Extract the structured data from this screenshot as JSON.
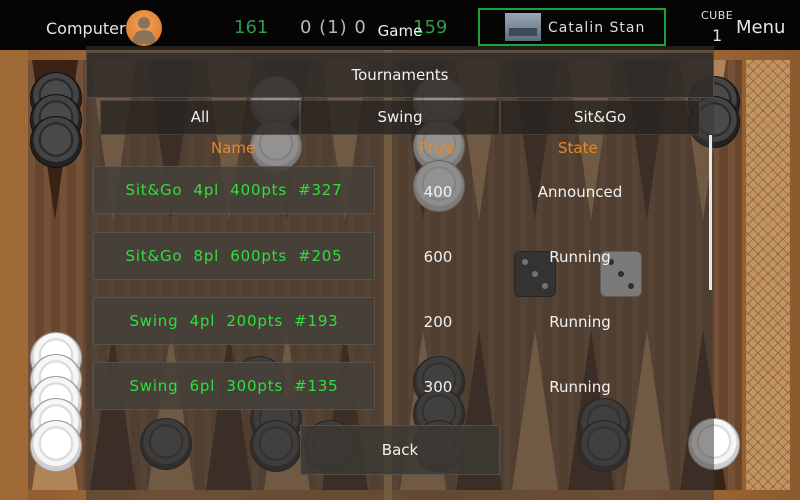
{
  "topbar": {
    "player1_name": "Computer",
    "player1_score": "161",
    "match_score": "0 (1) 0",
    "player2_score": "159",
    "game_menu_label": "Game",
    "player2_name": "Catalin Stan",
    "cube_label": "CUBE",
    "cube_value": "1",
    "menu_label": "Menu"
  },
  "dialog": {
    "title": "Tournaments",
    "tabs": [
      {
        "label": "All"
      },
      {
        "label": "Swing"
      },
      {
        "label": "Sit&Go"
      }
    ],
    "columns": {
      "name": "Name",
      "prize": "Prize",
      "state": "State"
    },
    "rows": [
      {
        "name": "Sit&Go  4pl  400pts  #327",
        "prize": "400",
        "state": "Announced"
      },
      {
        "name": "Sit&Go  8pl  600pts  #205",
        "prize": "600",
        "state": "Running"
      },
      {
        "name": "Swing  4pl  200pts  #193",
        "prize": "200",
        "state": "Running"
      },
      {
        "name": "Swing  6pl  300pts  #135",
        "prize": "300",
        "state": "Running"
      }
    ],
    "back_label": "Back"
  },
  "colors": {
    "accent_orange": "#e8872a",
    "tournament_green": "#2de03a",
    "score_green": "#2f9a48",
    "active_player_border": "#1ea136"
  },
  "icons": {
    "player1_avatar": "avatar-icon",
    "player2_avatar": "flag-icon"
  },
  "dice": [
    3,
    3
  ]
}
